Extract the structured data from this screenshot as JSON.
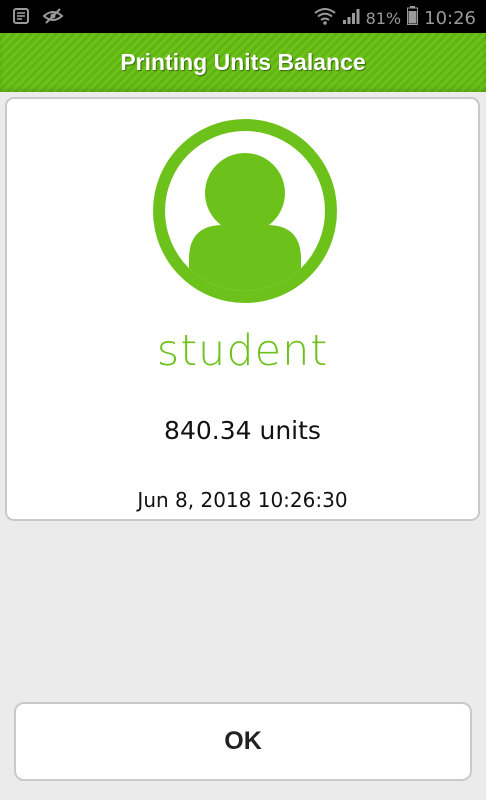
{
  "status_bar": {
    "battery_percent": "81%",
    "time": "10:26",
    "icons": [
      "notes-icon",
      "eye-off-icon",
      "wifi-icon",
      "signal-icon",
      "battery-icon"
    ]
  },
  "header": {
    "title": "Printing Units Balance"
  },
  "account": {
    "avatar_icon": "user-avatar-icon",
    "username": "student",
    "balance": "840.34 units",
    "timestamp": "Jun 8, 2018 10:26:30"
  },
  "actions": {
    "ok_label": "OK"
  },
  "colors": {
    "accent": "#6cc21a",
    "header": "#64b814",
    "card_border": "#c9c9c9",
    "background": "#ebebeb"
  }
}
